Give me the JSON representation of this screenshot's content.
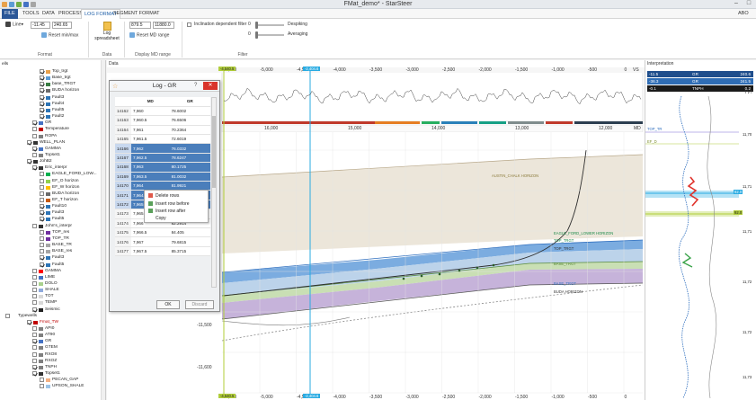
{
  "window": {
    "title": "FMat_demo* - StarSteer",
    "right_label": "ABO"
  },
  "menu": [
    "FILE",
    "TOOLS",
    "DATA",
    "PROCESS",
    "LOG FORMAT",
    "SEGMENT FORMAT"
  ],
  "ribbon": {
    "line_label": "Line",
    "range_min": "-11.45",
    "range_max": "240.65",
    "reset_minmax": "Reset min/max",
    "log_spreadsheet_1": "Log",
    "log_spreadsheet_2": "spreadsheet",
    "md_from": "879.5",
    "md_to": "11880.0",
    "reset_md_range": "Reset MD range",
    "incl_filter": "Inclination dependent filter",
    "despiking_val": "0",
    "despiking_label": "Despiking",
    "averaging_val": "0",
    "averaging_label": "Averaging",
    "group_format": "Format",
    "group_data": "Data",
    "group_display": "Display MD range",
    "group_filter": "Filter"
  },
  "left_panel": {
    "header": "ells",
    "items": [
      {
        "label": "Top_trgt",
        "checked": true,
        "color": "#e8a14c"
      },
      {
        "label": "Base_trgt",
        "checked": true,
        "color": "#5b9bd5"
      },
      {
        "label": "base_TRGT",
        "checked": true,
        "color": "#3a7d44"
      },
      {
        "label": "BUDA horizon",
        "checked": true,
        "color": "#6b6b6b"
      },
      {
        "label": "Fault3",
        "checked": true,
        "color": "#2e75b6"
      },
      {
        "label": "Fault4",
        "checked": true,
        "color": "#2e75b6"
      },
      {
        "label": "Fault5",
        "checked": true,
        "color": "#2e75b6"
      },
      {
        "label": "Fault2",
        "checked": true,
        "color": "#2e75b6"
      },
      {
        "label": "GR",
        "checked": true,
        "color": "#4472c4"
      },
      {
        "label": "Temperature",
        "checked": false,
        "color": "#c00000"
      },
      {
        "label": "ROPA",
        "checked": false,
        "color": "#7f7f7f"
      },
      {
        "label": "WELL_PLAN",
        "checked": true,
        "color": "#333333"
      },
      {
        "label": "GAMMA",
        "checked": true,
        "color": "#4472c4"
      },
      {
        "label": "Topset1",
        "checked": false,
        "color": "#7f7f7f"
      },
      {
        "label": "JohB2",
        "checked": true,
        "color": "#333333"
      },
      {
        "label": "Eric_interpr",
        "checked": true,
        "color": "#333333"
      },
      {
        "label": "EAGLE_FORD_LOW...",
        "checked": false,
        "color": "#00b050"
      },
      {
        "label": "EF_O horizon",
        "checked": false,
        "color": "#92d050"
      },
      {
        "label": "EF_W horizon",
        "checked": false,
        "color": "#ffc000"
      },
      {
        "label": "BUDA horizon",
        "checked": false,
        "color": "#6b6b6b"
      },
      {
        "label": "EF_T horizon",
        "checked": false,
        "color": "#c55a11"
      },
      {
        "label": "Fault10",
        "checked": true,
        "color": "#2e75b6"
      },
      {
        "label": "Fault3",
        "checked": true,
        "color": "#2e75b6"
      },
      {
        "label": "Fault5",
        "checked": true,
        "color": "#2e75b6"
      },
      {
        "label": "John's_interpr",
        "checked": false,
        "color": "#333333"
      },
      {
        "label": "TOP_res",
        "checked": false,
        "color": "#7030a0"
      },
      {
        "label": "TOP_TR",
        "checked": false,
        "color": "#7030a0"
      },
      {
        "label": "BASE_TR",
        "checked": false,
        "color": "#a5a5a5"
      },
      {
        "label": "BASE_res",
        "checked": false,
        "color": "#a5a5a5"
      },
      {
        "label": "Fault3",
        "checked": true,
        "color": "#2e75b6"
      },
      {
        "label": "Fault5",
        "checked": true,
        "color": "#2e75b6"
      },
      {
        "label": "GAMMA",
        "checked": false,
        "color": "#ff0000"
      },
      {
        "label": "LIME",
        "checked": false,
        "color": "#4472c4"
      },
      {
        "label": "DOLO",
        "checked": false,
        "color": "#a9d18e"
      },
      {
        "label": "SHALE",
        "checked": false,
        "color": "#8faadc"
      },
      {
        "label": "TOT",
        "checked": false,
        "color": "#d9d9d9"
      },
      {
        "label": "TEMP",
        "checked": false,
        "color": "#d9d9d9"
      },
      {
        "label": "Seismic",
        "checked": true,
        "color": "#222222"
      },
      {
        "label": "Typewells",
        "checked": false,
        "color": "#ffffff"
      },
      {
        "label": "Fmat_TW",
        "checked": true,
        "color": "#c00000"
      },
      {
        "label": "API0",
        "checked": false,
        "color": "#7f7f7f"
      },
      {
        "label": "AT90",
        "checked": false,
        "color": "#7f7f7f"
      },
      {
        "label": "GR",
        "checked": true,
        "color": "#4472c4"
      },
      {
        "label": "GTEM",
        "checked": false,
        "color": "#7f7f7f"
      },
      {
        "label": "RXO8",
        "checked": false,
        "color": "#7f7f7f"
      },
      {
        "label": "RXOZ",
        "checked": false,
        "color": "#7f7f7f"
      },
      {
        "label": "TNPH",
        "checked": true,
        "color": "#7f7f7f"
      },
      {
        "label": "Topset1",
        "checked": true,
        "color": "#333333"
      },
      {
        "label": "PECAN_GAP",
        "checked": false,
        "color": "#f4b183"
      },
      {
        "label": "UPSON_SHALE",
        "checked": false,
        "color": "#9dc3e6"
      }
    ]
  },
  "main": {
    "label": "Data",
    "top_ticks": [
      "-5,500",
      "-5,000",
      "-4,500",
      "-4,000",
      "-3,500",
      "-3,000",
      "-2,500",
      "-2,000",
      "-1,500",
      "-1,000",
      "-500",
      "0",
      "500"
    ],
    "top_unit": "VS",
    "md_ticks": [
      "16,000",
      "15,000",
      "14,000",
      "13,000",
      "12,000"
    ],
    "md_unit": "MD",
    "depth_ticks": [
      "-11,500",
      "-11,600"
    ],
    "marker_left": "-4,540.5",
    "marker_right": "-2,404.6",
    "horizons": [
      "AUSTIN_CHALK HORIZON",
      "EAGLE_FORD_LOWER HORIZON",
      "TOP_TRGT",
      "TOP_TRGT",
      "BASE_TRGT",
      "BASE_TRGT",
      "BUDA HORIZON"
    ]
  },
  "dialog": {
    "title": "Log - GR",
    "col_md": "MD",
    "col_gr": "GR",
    "rows": [
      {
        "idx": "14162",
        "md": "7,960",
        "gr": "78.6002",
        "sel": false
      },
      {
        "idx": "14163",
        "md": "7,960.5",
        "gr": "76.6506",
        "sel": false
      },
      {
        "idx": "14164",
        "md": "7,961",
        "gr": "70.2364",
        "sel": false
      },
      {
        "idx": "14165",
        "md": "7,961.5",
        "gr": "72.6019",
        "sel": false
      },
      {
        "idx": "14166",
        "md": "7,962",
        "gr": "76.0332",
        "sel": true
      },
      {
        "idx": "14167",
        "md": "7,962.5",
        "gr": "78.6247",
        "sel": true
      },
      {
        "idx": "14168",
        "md": "7,963",
        "gr": "80.1725",
        "sel": true
      },
      {
        "idx": "14169",
        "md": "7,963.5",
        "gr": "81.0032",
        "sel": true
      },
      {
        "idx": "14170",
        "md": "7,964",
        "gr": "81.9921",
        "sel": true
      },
      {
        "idx": "14171",
        "md": "7,964.5",
        "gr": "82.1043",
        "sel": true
      },
      {
        "idx": "14172",
        "md": "7,965",
        "gr": "82.4711",
        "sel": true
      },
      {
        "idx": "14173",
        "md": "7,965.5",
        "gr": "87.5298",
        "sel": false
      },
      {
        "idx": "14174",
        "md": "7,966",
        "gr": "82.2914",
        "sel": false
      },
      {
        "idx": "14175",
        "md": "7,966.5",
        "gr": "84.405",
        "sel": false
      },
      {
        "idx": "14176",
        "md": "7,967",
        "gr": "79.6815",
        "sel": false
      },
      {
        "idx": "14177",
        "md": "7,967.5",
        "gr": "85.3715",
        "sel": false
      }
    ],
    "ok": "OK",
    "discard": "Discard"
  },
  "context_menu": [
    "Delete rows",
    "Insert row before",
    "Insert row after",
    "Copy"
  ],
  "interpretation": {
    "title": "Interpretation",
    "rows": [
      {
        "a": "-11.5",
        "b": "GR",
        "c": "240.6",
        "bg": "#1f4e8c"
      },
      {
        "a": "-36.3",
        "b": "GR",
        "c": "241.5",
        "bg": "#2f6db5"
      },
      {
        "a": "-0.1",
        "b": "TNPH",
        "c": "0.2",
        "bg": "#1a1a1a"
      }
    ],
    "tvt": "TVT",
    "labels": [
      "TOP_TR",
      "EF_D"
    ],
    "depths": [
      "11,70",
      "11,71",
      "11,72",
      "11,73",
      "11,71",
      "11,72"
    ],
    "tags": [
      "92.0",
      "92.0"
    ]
  }
}
